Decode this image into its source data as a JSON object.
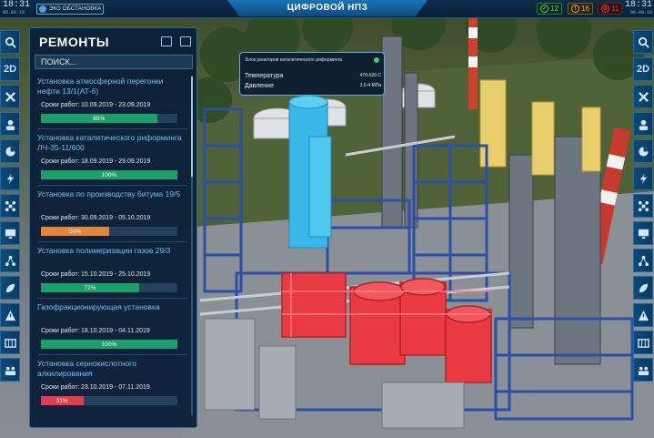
{
  "topbar": {
    "time_left": "18:31",
    "date_left": "06.09.19",
    "time_right": "18:31",
    "date_right": "06.09.19",
    "env_button": "ЭКО ОБСТАНОВКА",
    "title": "ЦИФРОВОЙ НПЗ",
    "status": [
      {
        "value": "12",
        "color": "#5cd06a"
      },
      {
        "value": "16",
        "color": "#e8b020"
      },
      {
        "value": "11",
        "color": "#e83c3c"
      }
    ]
  },
  "left_rail": [
    {
      "icon": "search-icon"
    },
    {
      "icon": "2d",
      "label": "2D"
    },
    {
      "icon": "tools-icon"
    },
    {
      "icon": "worker-icon"
    },
    {
      "icon": "pie-icon"
    },
    {
      "icon": "lightning-icon"
    },
    {
      "icon": "drone-icon"
    },
    {
      "icon": "monitor-icon"
    },
    {
      "icon": "network-icon"
    },
    {
      "icon": "leaf-icon"
    },
    {
      "icon": "warning-icon"
    },
    {
      "icon": "map-icon"
    },
    {
      "icon": "people-icon"
    }
  ],
  "panel": {
    "title": "РЕМОНТЫ",
    "search_placeholder": "ПОИСК...",
    "dates_label": "Сроки работ:",
    "items": [
      {
        "name": "Установка атмосферной перегонки нефти 13/1(АТ-6)",
        "dates": "10.09.2019 - 23.09.2019",
        "progress": 85,
        "progress_label": "85%",
        "color": "#1aa06a"
      },
      {
        "name": "Установка каталитического риформинга ЛЧ-35-11/600",
        "dates": "18.09.2019 - 29.09.2019",
        "progress": 100,
        "progress_label": "100%",
        "color": "#1aa06a"
      },
      {
        "name": "Установка по производству битума 19/5",
        "dates": "30.09.2019 - 05.10.2019",
        "progress": 50,
        "progress_label": "50%",
        "color": "#e8843a"
      },
      {
        "name": "Установка полимеризации газов 29/3",
        "dates": "15.10.2019 - 25.10.2019",
        "progress": 72,
        "progress_label": "72%",
        "color": "#1aa06a"
      },
      {
        "name": "Газофракционирующая установка",
        "dates": "18.10.2019 - 04.11.2019",
        "progress": 100,
        "progress_label": "100%",
        "color": "#1aa06a"
      },
      {
        "name": "Установка сернокислотного алкилирования",
        "dates": "23.10.2019 - 07.11.2019",
        "progress": 31,
        "progress_label": "31%",
        "color": "#e83c4a"
      }
    ]
  },
  "popup": {
    "title": "Блок реакторов каталитического риформинга",
    "rows": [
      {
        "label": "Температура",
        "value": "470-520 С"
      },
      {
        "label": "Давление",
        "value": "3,5-4 МПа"
      }
    ]
  }
}
